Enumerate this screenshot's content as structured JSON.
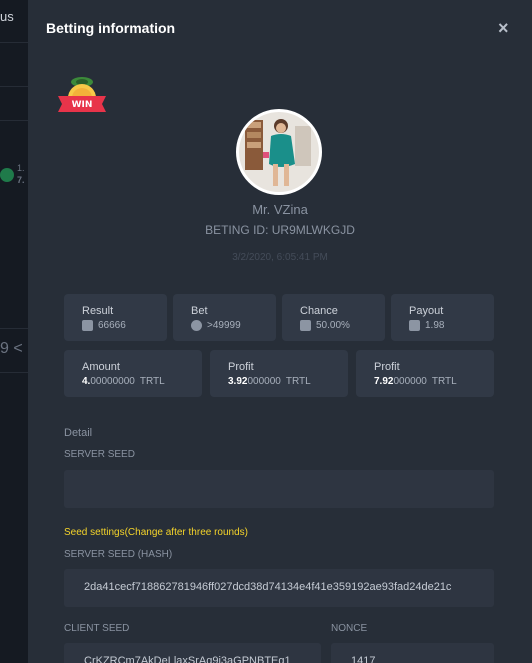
{
  "background": {
    "left_text": "us",
    "side_text_1": "1.",
    "side_text_2": "7.",
    "side_text_3": "9 <"
  },
  "modal": {
    "title": "Betting information",
    "close_symbol": "×",
    "win_badge": "WIN",
    "user_name": "Mr. VZina",
    "betting_id": "BETING ID: UR9MLWKGJD",
    "date": "3/2/2020, 6:05:41 PM"
  },
  "stats": {
    "result": {
      "label": "Result",
      "value": "66666"
    },
    "bet": {
      "label": "Bet",
      "value": ">49999"
    },
    "chance": {
      "label": "Chance",
      "value": "50.00%"
    },
    "payout": {
      "label": "Payout",
      "value": "1.98"
    },
    "amount": {
      "label": "Amount",
      "bold": "4.",
      "rest": "00000000",
      "unit": "TRTL"
    },
    "profit1": {
      "label": "Profit",
      "bold": "3.92",
      "rest": "000000",
      "unit": "TRTL"
    },
    "profit2": {
      "label": "Profit",
      "bold": "7.92",
      "rest": "000000",
      "unit": "TRTL"
    }
  },
  "detail": {
    "heading": "Detail",
    "server_seed_label": "SERVER SEED",
    "server_seed_value": "",
    "seed_settings": "Seed settings(Change after three rounds)",
    "server_seed_hash_label": "SERVER SEED (HASH)",
    "server_seed_hash_value": "2da41cecf718862781946ff027dcd38d74134e4f41e359192ae93fad24de21c",
    "client_seed_label": "CLIENT SEED",
    "client_seed_value": "CrKZRCm7AkDeLlaxSrAq9i3aGPNBTEq1",
    "nonce_label": "NONCE",
    "nonce_value": "1417"
  },
  "colors": {
    "modal_bg": "#272e38",
    "card_bg": "#313946",
    "accent_yellow": "#f5d42a",
    "win_red": "#e8344a"
  },
  "icons": [
    "close-icon",
    "win-badge-icon",
    "dice-icon",
    "coin-icon",
    "percent-icon",
    "payout-icon"
  ]
}
